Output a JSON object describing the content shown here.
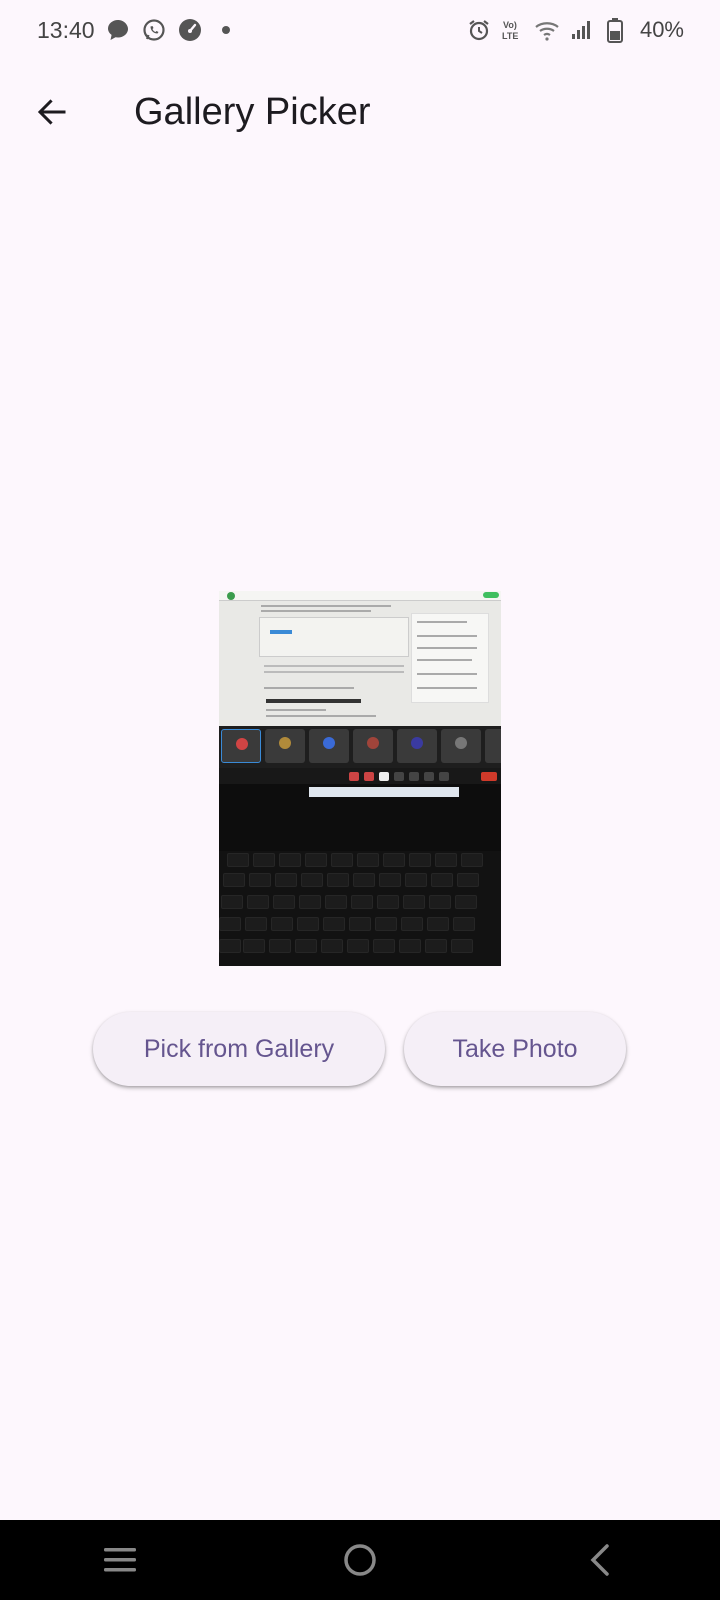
{
  "status_bar": {
    "time": "13:40",
    "battery_text": "40%",
    "icons_left": [
      "message-icon",
      "whatsapp-icon",
      "speedometer-icon",
      "dot-icon"
    ],
    "icons_right": [
      "alarm-icon",
      "volte-icon",
      "wifi-icon",
      "signal-icon",
      "battery-icon"
    ]
  },
  "app_bar": {
    "back_icon": "arrow-left-icon",
    "title": "Gallery Picker"
  },
  "preview": {
    "description_icon": "photo-preview"
  },
  "buttons": {
    "pick_gallery": "Pick from Gallery",
    "take_photo": "Take Photo"
  },
  "nav_bar": {
    "icons": [
      "menu-icon",
      "home-icon",
      "back-icon"
    ]
  },
  "colors": {
    "background": "#fdf7fd",
    "button_bg": "#f5eff7",
    "button_text": "#65558f",
    "nav_bar": "#000000"
  }
}
